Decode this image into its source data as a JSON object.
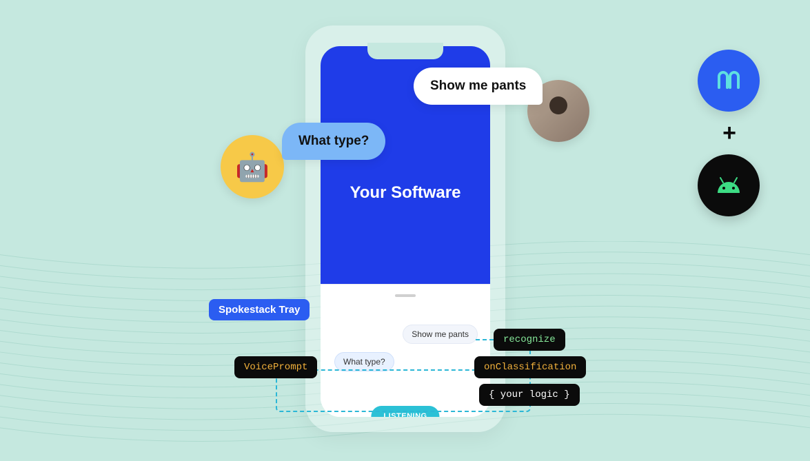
{
  "phone": {
    "app_title": "Your Software",
    "tray": {
      "msg_right": "Show me pants",
      "msg_left": "What type?",
      "listening_label": "LISTENING"
    }
  },
  "bubbles": {
    "user": "Show me pants",
    "bot": "What type?"
  },
  "avatars": {
    "bot_emoji": "🤖"
  },
  "labels": {
    "tray_label": "Spokestack Tray",
    "voice_prompt": "VoicePrompt",
    "recognize": "recognize",
    "on_classification": "onClassification",
    "your_logic": "{ your logic }"
  },
  "logos": {
    "plus": "+",
    "spokestack": "spokestack-logo",
    "android": "android-logo"
  },
  "colors": {
    "background": "#c5e8df",
    "primary_blue": "#1f3ce8",
    "accent_blue": "#2b5df1",
    "cyan": "#2bc1d6",
    "bubble_bot": "#7cb7f7",
    "tag_bg": "#0b0b0b",
    "tag_gold": "#f2b13b",
    "tag_green": "#86e89a",
    "avatar_bot_bg": "#f7c948"
  }
}
